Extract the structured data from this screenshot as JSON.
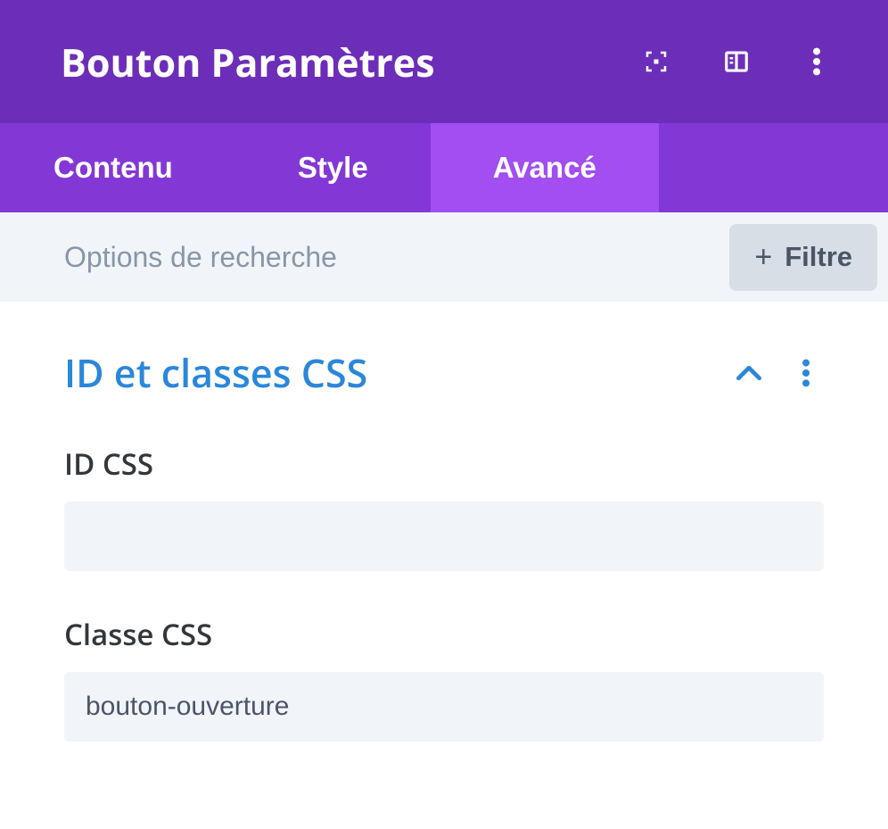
{
  "header": {
    "title": "Bouton Paramètres"
  },
  "tabs": [
    {
      "label": "Contenu",
      "active": false
    },
    {
      "label": "Style",
      "active": false
    },
    {
      "label": "Avancé",
      "active": true
    }
  ],
  "search": {
    "placeholder": "Options de recherche",
    "filter_label": "Filtre"
  },
  "section": {
    "title": "ID et classes CSS"
  },
  "fields": {
    "css_id": {
      "label": "ID CSS",
      "value": ""
    },
    "css_class": {
      "label": "Classe CSS",
      "value": "bouton-ouverture"
    }
  }
}
